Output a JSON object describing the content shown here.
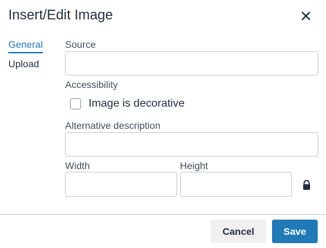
{
  "dialog": {
    "title": "Insert/Edit Image",
    "close_icon": "close-icon"
  },
  "tabs": [
    {
      "label": "General",
      "active": true
    },
    {
      "label": "Upload",
      "active": false
    }
  ],
  "form": {
    "source_label": "Source",
    "source_value": "",
    "accessibility_label": "Accessibility",
    "decorative_label": "Image is decorative",
    "decorative_checked": false,
    "alt_label": "Alternative description",
    "alt_value": "",
    "width_label": "Width",
    "width_value": "",
    "height_label": "Height",
    "height_value": "",
    "lock_icon": "lock-icon"
  },
  "footer": {
    "cancel_label": "Cancel",
    "save_label": "Save"
  },
  "colors": {
    "accent": "#207ab7",
    "text": "#222f3e",
    "border": "#cccccc"
  }
}
